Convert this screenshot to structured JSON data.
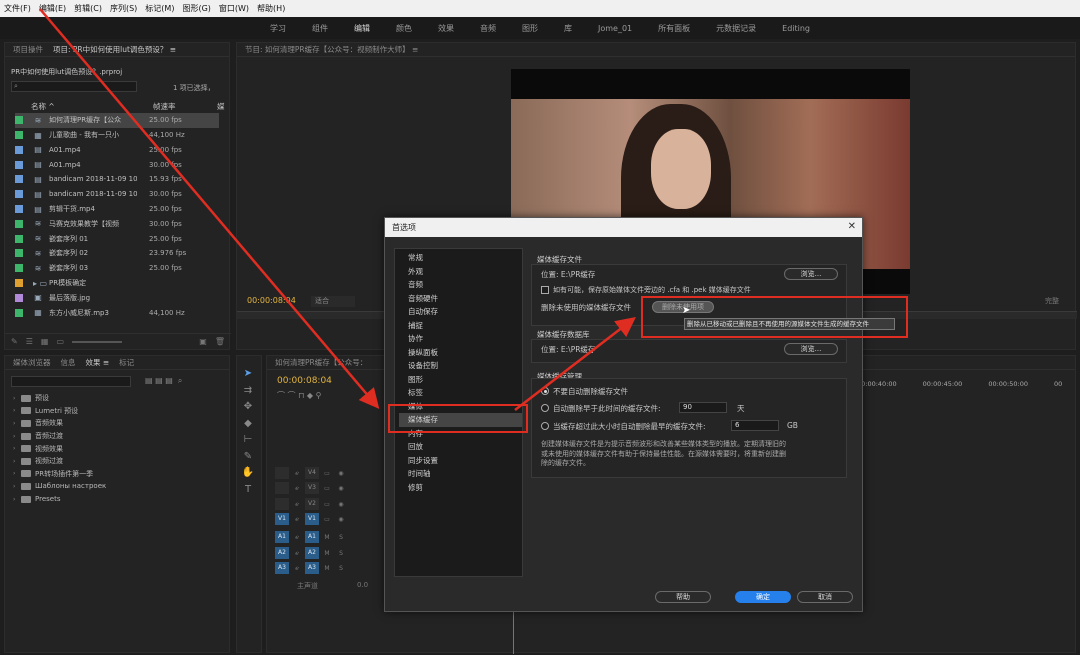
{
  "menu": [
    "文件(F)",
    "编辑(E)",
    "剪辑(C)",
    "序列(S)",
    "标记(M)",
    "图形(G)",
    "窗口(W)",
    "帮助(H)"
  ],
  "workspaces": [
    "学习",
    "组件",
    "编辑",
    "颜色",
    "效果",
    "音频",
    "图形",
    "库",
    "Jome_01",
    "所有面板",
    "元数据记录",
    "Editing"
  ],
  "project": {
    "tab1": "项目操件",
    "tab2": "项目: PR中如何使用lut调色预设？ ≡",
    "file": "PR中如何使用lut调色预设？.prproj",
    "selection": "1 项已选择，",
    "col_name": "名称 ^",
    "col_rate": "帧速率",
    "col_extra": "媒",
    "rows": [
      {
        "color": "#3db56a",
        "icon": "≋",
        "name": "如何清理PR缓存【公众",
        "rate": "25.00 fps",
        "sel": true
      },
      {
        "color": "#3db56a",
        "icon": "▦",
        "name": "儿童歌曲 - 我有一只小",
        "rate": "44,100 Hz"
      },
      {
        "color": "#6a9bd8",
        "icon": "▤",
        "name": "A01.mp4",
        "rate": "25.00 fps"
      },
      {
        "color": "#6a9bd8",
        "icon": "▤",
        "name": "A01.mp4",
        "rate": "30.00 fps"
      },
      {
        "color": "#6a9bd8",
        "icon": "▤",
        "name": "bandicam 2018-11-09 10-42-",
        "rate": "15.93 fps"
      },
      {
        "color": "#6a9bd8",
        "icon": "▤",
        "name": "bandicam 2018-11-09 10-47-",
        "rate": "30.00 fps"
      },
      {
        "color": "#6a9bd8",
        "icon": "▤",
        "name": "剪辑干货.mp4",
        "rate": "25.00 fps"
      },
      {
        "color": "#3db56a",
        "icon": "≋",
        "name": "马赛克效果教学【视频",
        "rate": "30.00 fps"
      },
      {
        "color": "#3db56a",
        "icon": "≋",
        "name": "嵌套序列 01",
        "rate": "25.00 fps"
      },
      {
        "color": "#3db56a",
        "icon": "≋",
        "name": "嵌套序列 02",
        "rate": "23.976 fps"
      },
      {
        "color": "#3db56a",
        "icon": "≋",
        "name": "嵌套序列 03",
        "rate": "25.00 fps"
      },
      {
        "color": "#e0a030",
        "icon": "▸ ▭",
        "name": "PR模板确定",
        "rate": ""
      },
      {
        "color": "#b08ad8",
        "icon": "▣",
        "name": "最后落版.jpg",
        "rate": ""
      },
      {
        "color": "#3db56a",
        "icon": "▦",
        "name": "东方小威尼斯.mp3",
        "rate": "44,100 Hz"
      }
    ]
  },
  "effects": {
    "tabs": [
      "媒体浏览器",
      "信息",
      "效果 ≡",
      "标记"
    ],
    "items": [
      "预设",
      "Lumetri 预设",
      "音频效果",
      "音频过渡",
      "视频效果",
      "视频过渡",
      "PR转场插件第一季",
      "Шаблоны настроек",
      "Presets"
    ]
  },
  "program": {
    "title": "节目: 如何清理PR缓存【公众号：视频制作大师】 ≡",
    "timecode": "00:00:08:04",
    "fit": "适合",
    "full": "完整"
  },
  "timeline": {
    "title": "如何清理PR缓存【公众号：",
    "timecode": "00:00:08:04",
    "ruler": [
      "00:00:40:00",
      "00:00:45:00",
      "00:00:50:00",
      "00"
    ],
    "tracks": [
      "V4",
      "V3",
      "V2",
      "V1",
      "A1",
      "A2",
      "A3"
    ],
    "master": "主声道",
    "master_val": "0.0"
  },
  "dialog": {
    "title": "首选项",
    "close": "✕",
    "categories": [
      "常规",
      "外观",
      "音频",
      "音频硬件",
      "自动保存",
      "捕捉",
      "协作",
      "操纵面板",
      "设备控制",
      "图形",
      "标签",
      "媒体",
      "媒体缓存",
      "内存",
      "回放",
      "同步设置",
      "时间轴",
      "修剪"
    ],
    "cache_files": {
      "title": "媒体缓存文件",
      "location_label": "位置: E:\\PR缓存",
      "browse": "浏览...",
      "checkbox": "如有可能，保存原始媒体文件旁边的 .cfa 和 .pek 媒体缓存文件",
      "delete_label": "删除未使用的媒体缓存文件",
      "delete_button": "删除未使用项"
    },
    "cache_db": {
      "title": "媒体缓存数据库",
      "location_label": "位置: E:\\PR缓存",
      "browse": "浏览..."
    },
    "cache_mgmt": {
      "title": "媒体缓存管理",
      "opt1": "不要自动删除缓存文件",
      "opt2": "自动删除早于此时间的缓存文件:",
      "opt2_value": "90",
      "opt2_unit": "天",
      "opt3": "当缓存超过此大小时自动删除最早的缓存文件:",
      "opt3_value": "6",
      "opt3_unit": "GB",
      "desc": "创建媒体缓存文件是为提示音频波形和改善某些媒体类型的播放。定期清理旧的或未使用的媒体缓存文件有助于保持最佳性能。在源媒体需要时，将重新创建删除的缓存文件。"
    },
    "help": "帮助",
    "ok": "确定",
    "cancel": "取消"
  },
  "tooltip": "删除从已移动或已删除且不再使用的源媒体文件生成的缓存文件",
  "colors": {
    "accent": "#2680eb",
    "annotation": "#e02d22"
  }
}
